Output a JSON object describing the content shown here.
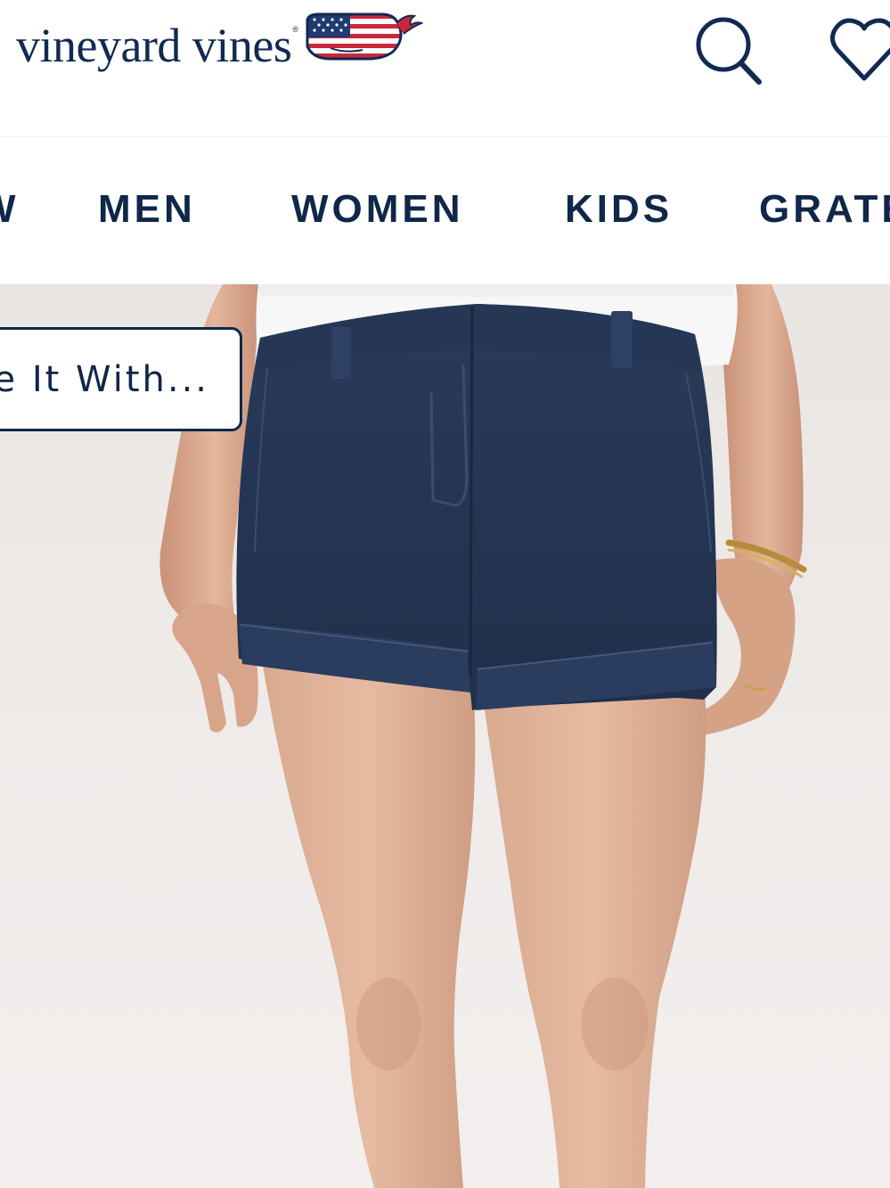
{
  "header": {
    "brand": "vineyard vines",
    "brand_mark": "®",
    "logo_icon": "flag-whale-icon",
    "search_icon": "search-icon",
    "wishlist_icon": "heart-icon"
  },
  "nav": {
    "items": [
      {
        "label": "W"
      },
      {
        "label": "MEN"
      },
      {
        "label": "WOMEN"
      },
      {
        "label": "KIDS"
      },
      {
        "label": "GRATE"
      }
    ]
  },
  "hero": {
    "image": "Model wearing navy chino shorts with white tee",
    "style_button_label": "e It With..."
  },
  "colors": {
    "brand_navy": "#0f2749",
    "background": "#ffffff",
    "hero_backdrop": "#ece8e6",
    "shorts_navy": "#233452"
  }
}
